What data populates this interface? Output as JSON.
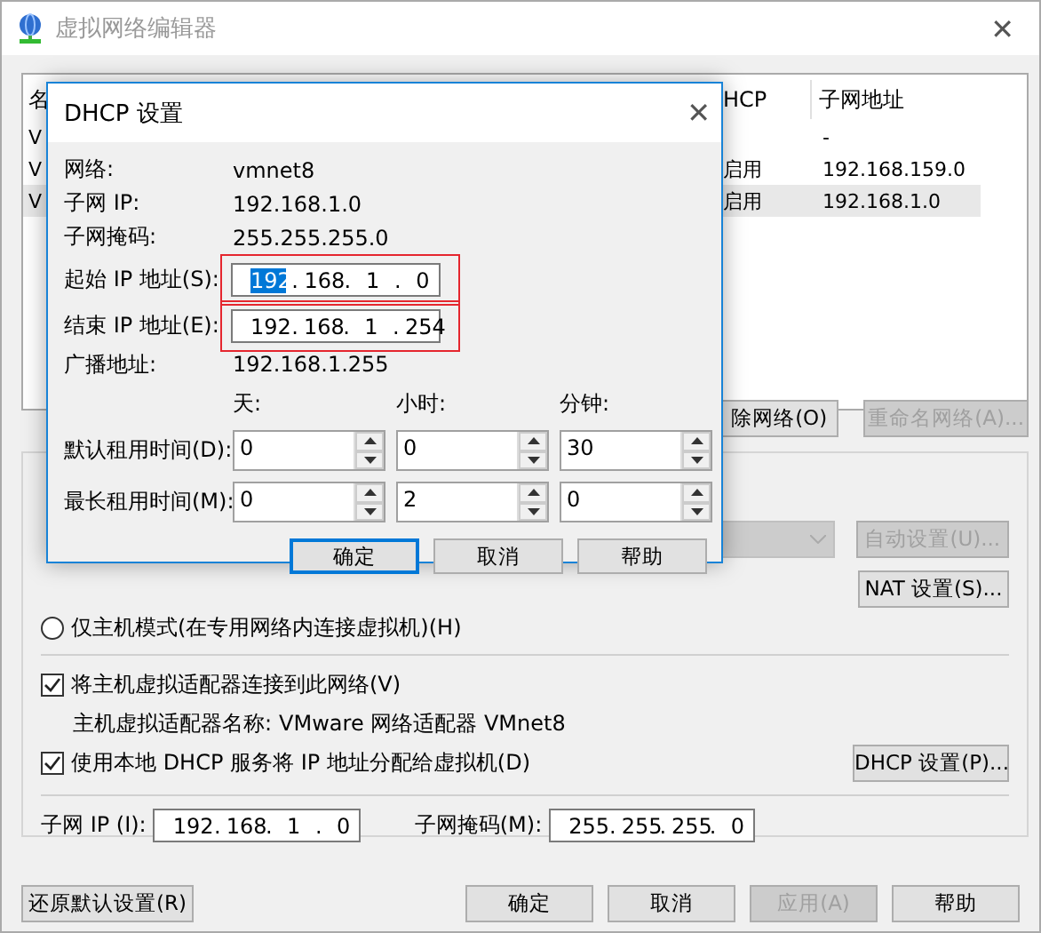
{
  "window": {
    "title": "虚拟网络编辑器",
    "close": "✕"
  },
  "network_list": {
    "columns": [
      {
        "label": "名"
      },
      {
        "label": "HCP"
      },
      {
        "label": "子网地址"
      }
    ],
    "rows": [
      {
        "name": "V",
        "dhcp": "",
        "subnet": "-",
        "selected": false
      },
      {
        "name": "V",
        "dhcp": "启用",
        "subnet": "192.168.159.0",
        "selected": false
      },
      {
        "name": "V",
        "dhcp": "启用",
        "subnet": "192.168.1.0",
        "selected": true
      }
    ]
  },
  "list_buttons": [
    {
      "label": "除网络(O)",
      "disabled": false
    },
    {
      "label": "重命名网络(A)...",
      "disabled": true
    }
  ],
  "vmnet_info": {
    "nat_combo_disabled": true,
    "auto_button": {
      "label": "自动设置(U)...",
      "disabled": true
    },
    "nat_button": {
      "label": "NAT 设置(S)..."
    },
    "host_only": {
      "label": "仅主机模式(在专用网络内连接虚拟机)(H)",
      "selected": false
    },
    "connect_adapter": {
      "label": "将主机虚拟适配器连接到此网络(V)",
      "checked": true
    },
    "adapter_name": {
      "label": "主机虚拟适配器名称:",
      "value": "VMware 网络适配器 VMnet8"
    },
    "use_dhcp": {
      "label": "使用本地 DHCP 服务将 IP 地址分配给虚拟机(D)",
      "checked": true
    },
    "dhcp_button": {
      "label": "DHCP 设置(P)..."
    },
    "subnet_ip": {
      "label": "子网 IP (I):",
      "separator": ".",
      "octets": [
        {
          "text": "192",
          "selected": false
        },
        {
          "text": "168",
          "selected": false
        },
        {
          "text": "1",
          "selected": false
        },
        {
          "text": "0",
          "selected": false
        }
      ]
    },
    "subnet_mask": {
      "label": "子网掩码(M):",
      "separator": ".",
      "octets": [
        {
          "text": "255",
          "selected": false
        },
        {
          "text": "255",
          "selected": false
        },
        {
          "text": "255",
          "selected": false
        },
        {
          "text": "0",
          "selected": false
        }
      ]
    }
  },
  "footer": {
    "restore": "还原默认设置(R)",
    "buttons": [
      {
        "label": "确定",
        "disabled": false
      },
      {
        "label": "取消",
        "disabled": false
      },
      {
        "label": "应用(A)",
        "disabled": true
      },
      {
        "label": "帮助",
        "disabled": false
      }
    ]
  },
  "dhcp_dialog": {
    "title": "DHCP 设置",
    "close": "✕",
    "info": [
      {
        "label": "网络:",
        "value": "vmnet8"
      },
      {
        "label": "子网 IP:",
        "value": "192.168.1.0"
      },
      {
        "label": "子网掩码:",
        "value": "255.255.255.0"
      }
    ],
    "ranges": [
      {
        "label": "起始 IP 地址(S):",
        "highlighted": true,
        "separator": ".",
        "octets": [
          {
            "text": "192",
            "selected": true
          },
          {
            "text": "168",
            "selected": false
          },
          {
            "text": "1",
            "selected": false
          },
          {
            "text": "0",
            "selected": false
          }
        ]
      },
      {
        "label": "结束 IP 地址(E):",
        "highlighted": true,
        "separator": ".",
        "octets": [
          {
            "text": "192",
            "selected": false
          },
          {
            "text": "168",
            "selected": false
          },
          {
            "text": "1",
            "selected": false
          },
          {
            "text": "254",
            "selected": false
          }
        ]
      }
    ],
    "broadcast": {
      "label": "广播地址:",
      "value": "192.168.1.255"
    },
    "lease_units": [
      "天:",
      "小时:",
      "分钟:"
    ],
    "leases": [
      {
        "label": "默认租用时间(D):",
        "values": [
          "0",
          "0",
          "30"
        ]
      },
      {
        "label": "最长租用时间(M):",
        "values": [
          "0",
          "2",
          "0"
        ]
      }
    ],
    "buttons": [
      {
        "label": "确定",
        "default": true
      },
      {
        "label": "取消",
        "default": false
      },
      {
        "label": "帮助",
        "default": false
      }
    ]
  }
}
